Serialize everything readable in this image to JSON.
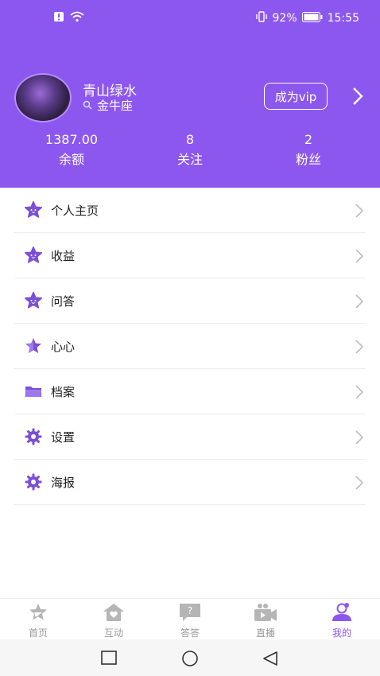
{
  "status_bar": {
    "battery": "92%",
    "time": "15:55"
  },
  "profile": {
    "username": "青山绿水",
    "zodiac": "金牛座",
    "vip_button": "成为vip"
  },
  "stats": [
    {
      "value": "1387.00",
      "label": "余额"
    },
    {
      "value": "8",
      "label": "关注"
    },
    {
      "value": "2",
      "label": "粉丝"
    }
  ],
  "menu": [
    {
      "label": "个人主页",
      "icon": "star-face-icon"
    },
    {
      "label": "收益",
      "icon": "star-face-icon"
    },
    {
      "label": "问答",
      "icon": "star-face-icon"
    },
    {
      "label": "心心",
      "icon": "star-icon"
    },
    {
      "label": "档案",
      "icon": "folder-icon"
    },
    {
      "label": "设置",
      "icon": "gear-icon"
    },
    {
      "label": "海报",
      "icon": "gear-icon"
    }
  ],
  "tabbar": [
    {
      "label": "首页",
      "icon": "home-star-icon",
      "active": false
    },
    {
      "label": "互动",
      "icon": "house-heart-icon",
      "active": false
    },
    {
      "label": "答答",
      "icon": "question-bubble-icon",
      "active": false
    },
    {
      "label": "直播",
      "icon": "video-camera-icon",
      "active": false
    },
    {
      "label": "我的",
      "icon": "profile-icon",
      "active": true
    }
  ],
  "colors": {
    "accent": "#8c57ee",
    "inactive_tab": "#9b9b9b"
  }
}
